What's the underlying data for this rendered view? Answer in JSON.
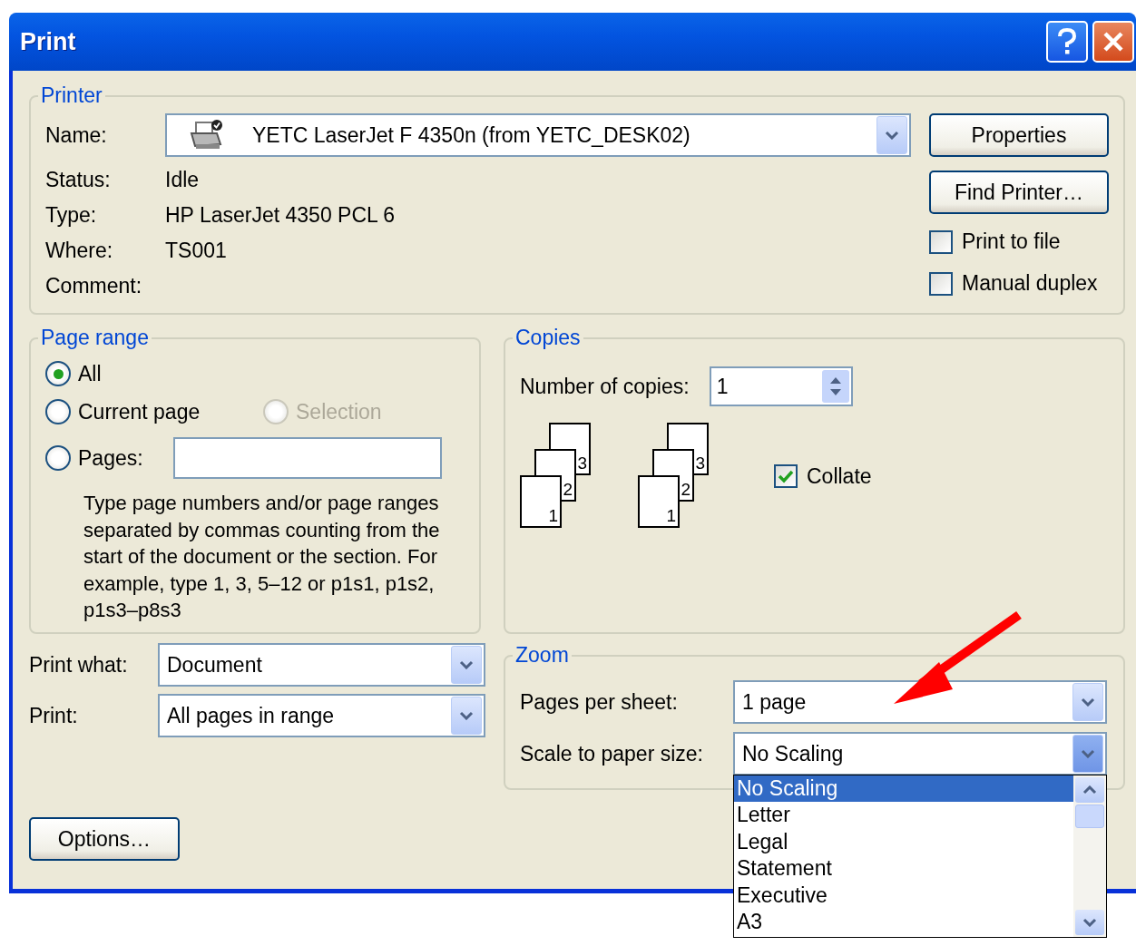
{
  "window": {
    "title": "Print"
  },
  "printer": {
    "title": "Printer",
    "name_label": "Name:",
    "name": "YETC LaserJet F 4350n (from YETC_DESK02)",
    "info": [
      {
        "label": "Status:",
        "value": "Idle"
      },
      {
        "label": "Type:",
        "value": "HP LaserJet 4350 PCL 6"
      },
      {
        "label": "Where:",
        "value": "TS001"
      },
      {
        "label": "Comment:"
      }
    ],
    "buttons": [
      "Properties",
      "Find Printer…"
    ],
    "options": [
      {
        "label": "Print to file",
        "checked": false
      },
      {
        "label": "Manual duplex",
        "checked": false
      }
    ]
  },
  "page_range": {
    "title": "Page range",
    "options": [
      {
        "label": "All",
        "selected": true,
        "disabled": false
      },
      {
        "label": "Current page",
        "selected": false,
        "disabled": false
      },
      {
        "label": "Selection",
        "selected": false,
        "disabled": true
      },
      {
        "label": "Pages:",
        "selected": false,
        "disabled": false
      }
    ],
    "hint": "Type page numbers and/or page ranges separated by commas counting from the start of the document or the section. For example, type 1, 3, 5–12 or p1s1, p1s2, p1s3–p8s3"
  },
  "copies": {
    "title": "Copies",
    "label": "Number of copies:",
    "value": "1",
    "stacks": [
      {
        "pages": [
          "3",
          "2",
          "1"
        ]
      },
      {
        "pages": [
          "3",
          "2",
          "1"
        ]
      }
    ],
    "collate": {
      "label": "Collate",
      "checked": true
    }
  },
  "print_settings": [
    {
      "label": "Print what:",
      "value": "Document"
    },
    {
      "label": "Print:",
      "value": "All pages in range"
    }
  ],
  "zoom": {
    "title": "Zoom",
    "rows": [
      {
        "label": "Pages per sheet:",
        "value": "1 page",
        "open": false
      },
      {
        "label": "Scale to paper size:",
        "value": "No Scaling",
        "open": true
      }
    ],
    "list": [
      {
        "label": "No Scaling",
        "selected": true
      },
      {
        "label": "Letter",
        "selected": false
      },
      {
        "label": "Legal",
        "selected": false
      },
      {
        "label": "Statement",
        "selected": false
      },
      {
        "label": "Executive",
        "selected": false
      },
      {
        "label": "A3",
        "selected": false
      }
    ]
  },
  "buttons": [
    "Options…"
  ]
}
